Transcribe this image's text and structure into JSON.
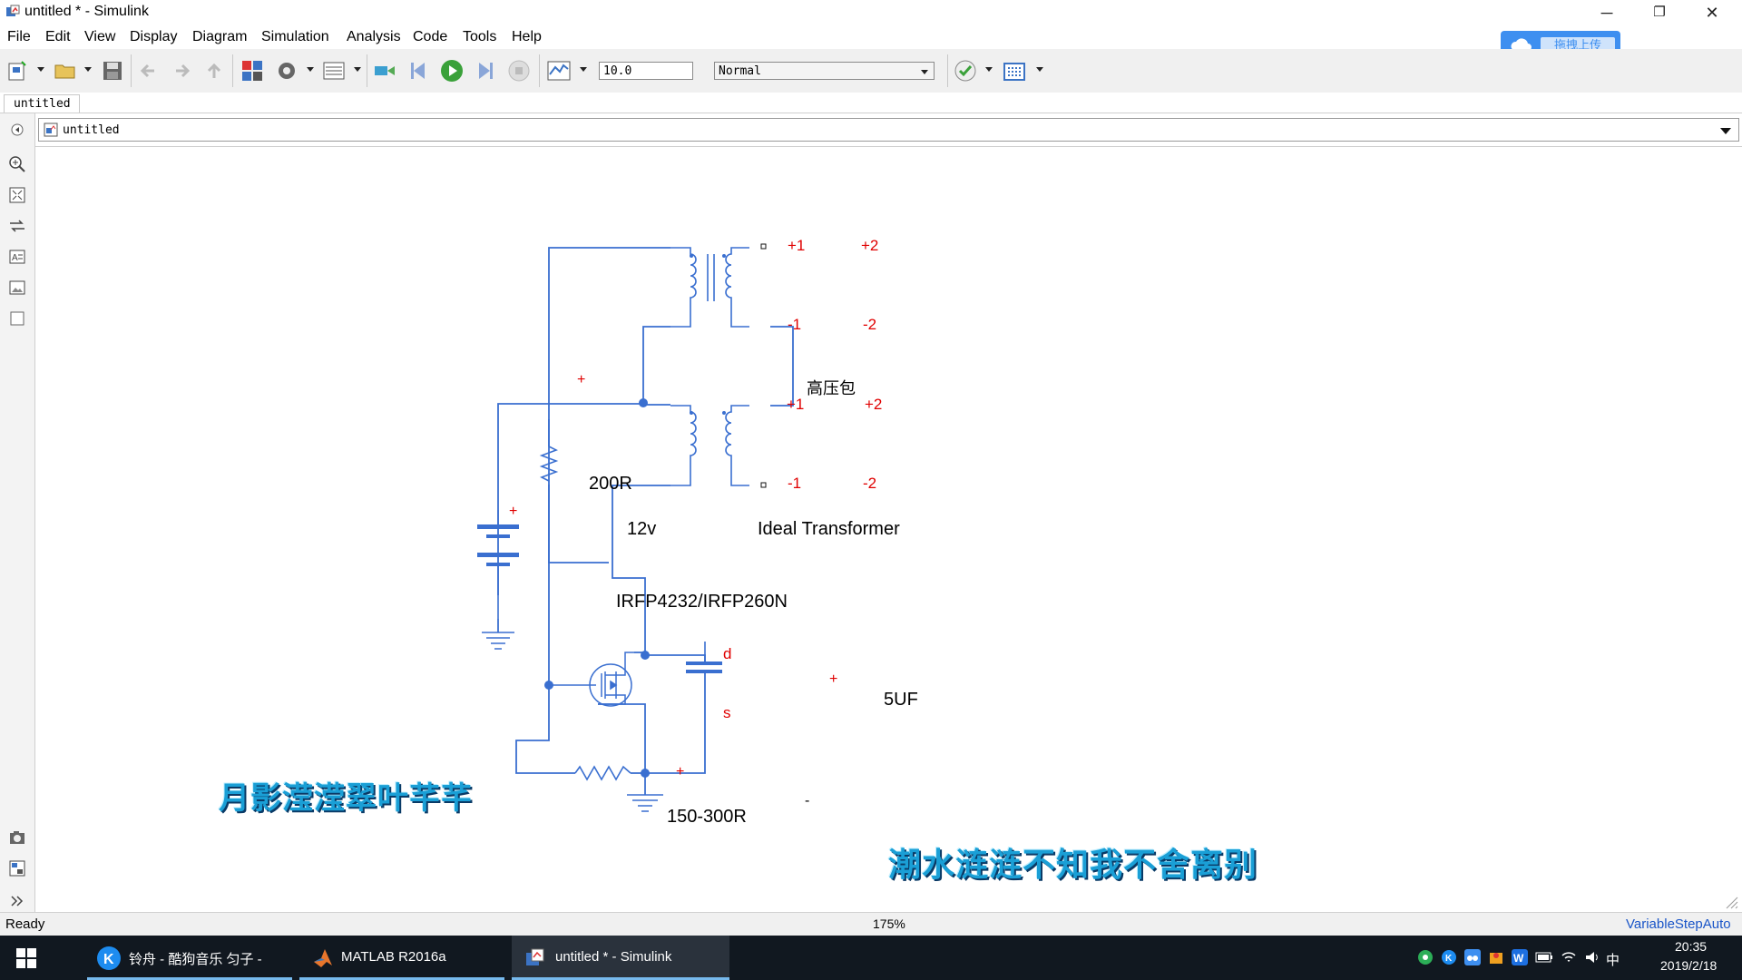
{
  "window": {
    "title": "untitled * - Simulink",
    "controls": {
      "minimize": "─",
      "restore": "❐",
      "close": "✕"
    }
  },
  "menu": [
    "File",
    "Edit",
    "View",
    "Display",
    "Diagram",
    "Simulation",
    "Analysis",
    "Code",
    "Tools",
    "Help"
  ],
  "toolbar": {
    "stop_time": "10.0",
    "sim_mode": "Normal",
    "icons": [
      "new-model-icon",
      "open-icon",
      "save-icon",
      "back-icon",
      "forward-icon",
      "up-icon",
      "library-browser-icon",
      "model-config-icon",
      "model-explorer-icon",
      "step-back-icon",
      "run-icon",
      "step-forward-icon",
      "stop-icon",
      "record-icon",
      "model-advisor-icon",
      "build-icon"
    ]
  },
  "cloud_upload": {
    "label": "拖拽上传"
  },
  "tabs": [
    {
      "label": "untitled"
    }
  ],
  "breadcrumb": {
    "path": "untitled"
  },
  "diagram": {
    "transformer_top_block": {
      "name": "高压包",
      "ports": [
        "+1",
        "+2",
        "-1",
        "-2"
      ]
    },
    "transformer_bottom_block": {
      "name": "Ideal Transformer",
      "ports": [
        "+1",
        "+2",
        "-1",
        "-2"
      ]
    },
    "battery": {
      "label": "12v",
      "pos_sign": "+"
    },
    "resistor_gate": {
      "label": "200R",
      "pos_sign": "+"
    },
    "mosfet": {
      "label": "IRFP4232/IRFP260N",
      "drain": "d",
      "source": "s"
    },
    "capacitor": {
      "label": "5UF",
      "pos_sign": "+"
    },
    "resistor_source": {
      "label": "150-300R",
      "pos_sign": "+"
    },
    "ground_minus": "-"
  },
  "lyrics": {
    "line1": "月影滢滢翠叶芊芊",
    "line2": "潮水涟涟不知我不舍离别"
  },
  "status": {
    "state": "Ready",
    "zoom": "175%",
    "solver": "VariableStepAuto"
  },
  "taskbar": {
    "items": [
      {
        "label": "铃舟 - 酷狗音乐 匀子 -",
        "icon": "kugou-icon"
      },
      {
        "label": "MATLAB R2016a",
        "icon": "matlab-icon"
      },
      {
        "label": "untitled * - Simulink",
        "icon": "simulink-icon"
      }
    ],
    "tray": {
      "ime": "中",
      "time": "20:35",
      "date": "2019/2/18"
    }
  },
  "colors": {
    "wire": "#3a6fd0",
    "port_label": "#e00000",
    "lyric": "#1a9fd6"
  }
}
